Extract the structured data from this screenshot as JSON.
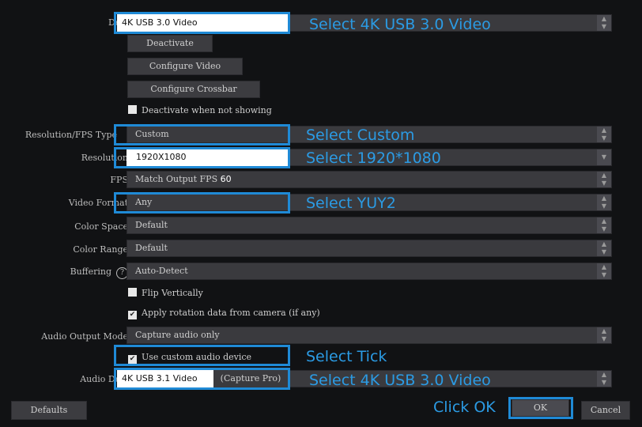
{
  "rows": {
    "device": {
      "label": "Devi",
      "value": "4K USB 3.0 Video"
    },
    "deactivate": "Deactivate",
    "configure_video": "Configure Video",
    "configure_crossbar": "Configure Crossbar",
    "deactivate_not_showing": "Deactivate when not showing",
    "res_fps_type": {
      "label": "Resolution/FPS Type",
      "value": "Custom"
    },
    "resolution": {
      "label": "Resolution",
      "value": "1920X1080"
    },
    "fps": {
      "label": "FPS",
      "value": "Match Output FPS",
      "extra": "60"
    },
    "video_format": {
      "label": "Video Format",
      "value": "Any"
    },
    "color_space": {
      "label": "Color Space",
      "value": "Default"
    },
    "color_range": {
      "label": "Color Range",
      "value": "Default"
    },
    "buffering": {
      "label": "Buffering",
      "value": "Auto-Detect"
    },
    "flip_vertically": "Flip Vertically",
    "apply_rotation": "Apply rotation data from camera (if any)",
    "audio_output_mode": {
      "label": "Audio Output Mode",
      "value": "Capture audio only"
    },
    "use_custom_audio": "Use custom audio device",
    "audio_device": {
      "label": "Audio Devi",
      "value": "4K USB 3.1 Video",
      "suffix": "(Capture Pro)"
    }
  },
  "footer": {
    "defaults": "Defaults",
    "ok": "OK",
    "cancel": "Cancel"
  },
  "annotations": {
    "device": "Select 4K USB 3.0 Video",
    "custom": "Select Custom",
    "resolution": "Select 1920*1080",
    "yuy2": "Select YUY2",
    "tick": "Select Tick",
    "audio_device": "Select 4K USB 3.0 Video",
    "ok": "Click OK"
  },
  "colors": {
    "accent": "#1f8ad6",
    "annotation_text": "#2b9be4",
    "background": "#111214"
  }
}
